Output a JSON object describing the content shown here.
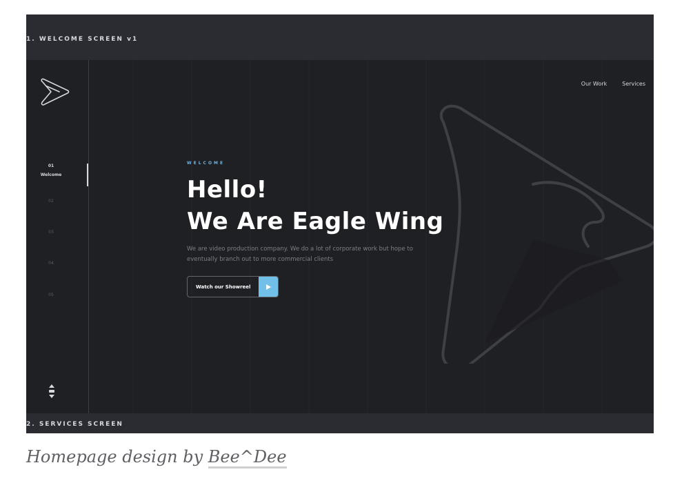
{
  "screenshot": {
    "top_label": "1. WELCOME SCREEN v1",
    "bottom_label": "2. SERVICES SCREEN"
  },
  "sidebar": {
    "logo_icon": "play-arrow-logo-icon",
    "steps": [
      {
        "number": "01",
        "label": "Welcome"
      },
      {
        "number": "02"
      },
      {
        "number": "03"
      },
      {
        "number": "04"
      },
      {
        "number": "05"
      }
    ],
    "scroll_icon": "scroll-indicator-icon"
  },
  "topnav": {
    "items": [
      "Our Work",
      "Services"
    ]
  },
  "hero": {
    "eyebrow": "WELCOME",
    "headline_line1": "Hello!",
    "headline_line2": "We Are Eagle Wing",
    "description": "We are video production company. We do a lot of corporate work but hope to eventually branch out to more commercial clients",
    "cta_label": "Watch our Showreel",
    "cta_icon": "play-icon"
  },
  "caption": {
    "prefix": "Homepage design by ",
    "author": "Bee^Dee"
  },
  "colors": {
    "background": "#1f2024",
    "accent": "#71c0ea",
    "text": "#ffffff"
  }
}
